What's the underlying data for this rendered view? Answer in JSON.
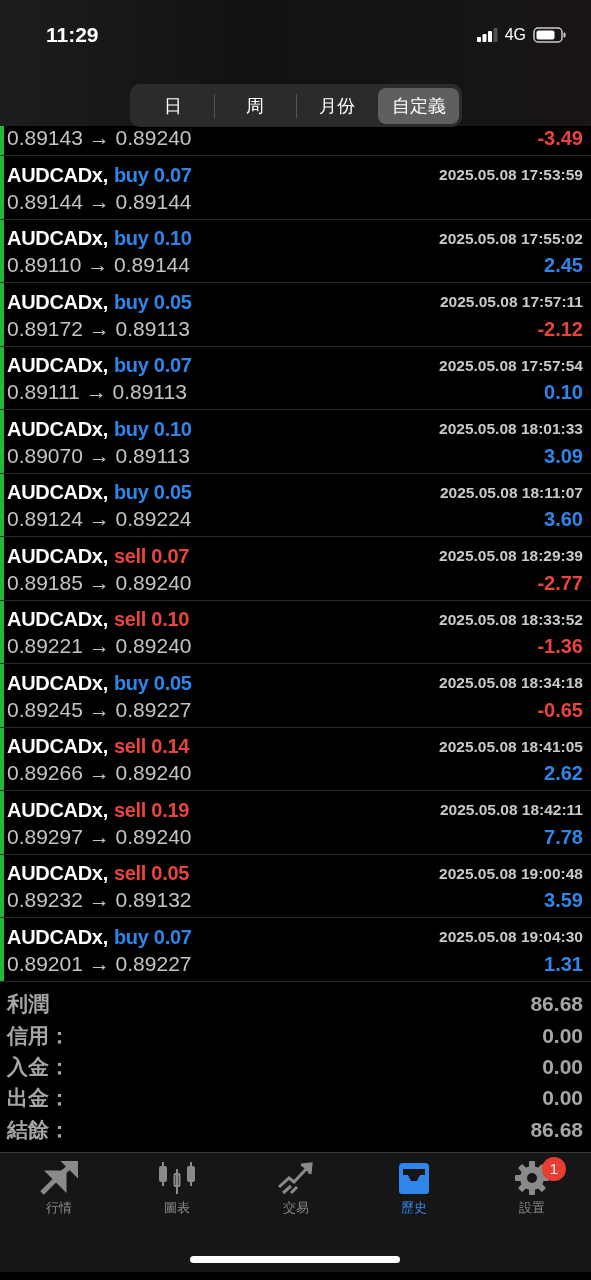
{
  "status_bar": {
    "time": "11:29",
    "network": "4G"
  },
  "period_tabs": [
    {
      "label": "日",
      "selected": false
    },
    {
      "label": "周",
      "selected": false
    },
    {
      "label": "月份",
      "selected": false
    },
    {
      "label": "自定義",
      "selected": true
    }
  ],
  "partial_deal": {
    "prices": "0.89143 → 0.89240",
    "profit": "-3.49",
    "color": "#e8453c"
  },
  "deals": [
    {
      "symbol": "AUDCADx,",
      "kind": "buy",
      "action": "buy 0.07",
      "time": "2025.05.08 17:53:59",
      "prices": "0.89144 → 0.89144"
    },
    {
      "symbol": "AUDCADx,",
      "kind": "buy",
      "action": "buy 0.10",
      "time": "2025.05.08 17:55:02",
      "prices": "0.89110 → 0.89144",
      "profit": "2.45",
      "color": "#2f86ea"
    },
    {
      "symbol": "AUDCADx,",
      "kind": "buy",
      "action": "buy 0.05",
      "time": "2025.05.08 17:57:11",
      "prices": "0.89172 → 0.89113",
      "profit": "-2.12",
      "color": "#e8453c"
    },
    {
      "symbol": "AUDCADx,",
      "kind": "buy",
      "action": "buy 0.07",
      "time": "2025.05.08 17:57:54",
      "prices": "0.89111 → 0.89113",
      "profit": "0.10",
      "color": "#2f86ea"
    },
    {
      "symbol": "AUDCADx,",
      "kind": "buy",
      "action": "buy 0.10",
      "time": "2025.05.08 18:01:33",
      "prices": "0.89070 → 0.89113",
      "profit": "3.09",
      "color": "#2f86ea"
    },
    {
      "symbol": "AUDCADx,",
      "kind": "buy",
      "action": "buy 0.05",
      "time": "2025.05.08 18:11:07",
      "prices": "0.89124 → 0.89224",
      "profit": "3.60",
      "color": "#2f86ea"
    },
    {
      "symbol": "AUDCADx,",
      "kind": "sell",
      "action": "sell 0.07",
      "time": "2025.05.08 18:29:39",
      "prices": "0.89185 → 0.89240",
      "profit": "-2.77",
      "color": "#e8453c"
    },
    {
      "symbol": "AUDCADx,",
      "kind": "sell",
      "action": "sell 0.10",
      "time": "2025.05.08 18:33:52",
      "prices": "0.89221 → 0.89240",
      "profit": "-1.36",
      "color": "#e8453c"
    },
    {
      "symbol": "AUDCADx,",
      "kind": "buy",
      "action": "buy 0.05",
      "time": "2025.05.08 18:34:18",
      "prices": "0.89245 → 0.89227",
      "profit": "-0.65",
      "color": "#e8453c"
    },
    {
      "symbol": "AUDCADx,",
      "kind": "sell",
      "action": "sell 0.14",
      "time": "2025.05.08 18:41:05",
      "prices": "0.89266 → 0.89240",
      "profit": "2.62",
      "color": "#2f86ea"
    },
    {
      "symbol": "AUDCADx,",
      "kind": "sell",
      "action": "sell 0.19",
      "time": "2025.05.08 18:42:11",
      "prices": "0.89297 → 0.89240",
      "profit": "7.78",
      "color": "#2f86ea"
    },
    {
      "symbol": "AUDCADx,",
      "kind": "sell",
      "action": "sell 0.05",
      "time": "2025.05.08 19:00:48",
      "prices": "0.89232 → 0.89132",
      "profit": "3.59",
      "color": "#2f86ea"
    },
    {
      "symbol": "AUDCADx,",
      "kind": "buy",
      "action": "buy 0.07",
      "time": "2025.05.08 19:04:30",
      "prices": "0.89201 → 0.89227",
      "profit": "1.31",
      "color": "#2f86ea"
    }
  ],
  "summary": [
    {
      "label": "利潤",
      "value": "86.68"
    },
    {
      "label": "信用：",
      "value": "0.00"
    },
    {
      "label": "入金：",
      "value": "0.00"
    },
    {
      "label": "出金：",
      "value": "0.00"
    },
    {
      "label": "結餘：",
      "value": "86.68"
    }
  ],
  "tab_bar": [
    {
      "kind": "quotes",
      "label": "行情",
      "selected": false
    },
    {
      "kind": "chart",
      "label": "圖表",
      "selected": false
    },
    {
      "kind": "trade",
      "label": "交易",
      "selected": false
    },
    {
      "kind": "history",
      "label": "歷史",
      "selected": true
    },
    {
      "kind": "settings",
      "label": "設置",
      "selected": false,
      "badge": "1"
    }
  ]
}
